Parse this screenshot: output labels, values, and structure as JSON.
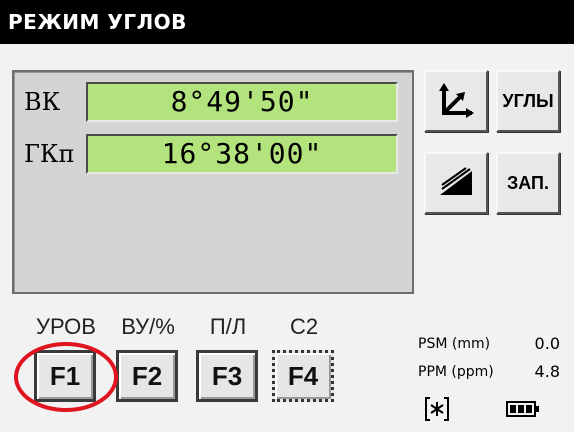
{
  "title": "РЕЖИМ УГЛОВ",
  "rows": [
    {
      "label": "ВК",
      "value": "8°49'50\""
    },
    {
      "label": "ГКп",
      "value": "16°38'00\""
    }
  ],
  "side_buttons": {
    "angles_label": "УГЛЫ",
    "record_label": "ЗАП.",
    "coords_icon": "axes-icon",
    "target_icon": "prism-icon"
  },
  "function_keys": [
    {
      "label": "УРОВ",
      "key": "F1"
    },
    {
      "label": "ВУ/%",
      "key": "F2"
    },
    {
      "label": "П/Л",
      "key": "F3"
    },
    {
      "label": "С2",
      "key": "F4"
    }
  ],
  "status": {
    "psm_label": "PSM (mm)",
    "psm_value": "0.0",
    "ppm_label": "PPM (ppm)",
    "ppm_value": "4.8",
    "laser_icon": "laser-icon",
    "battery_icon": "battery-icon"
  },
  "colors": {
    "value_bg": "#b3e37c",
    "highlight": "#e0141e"
  }
}
